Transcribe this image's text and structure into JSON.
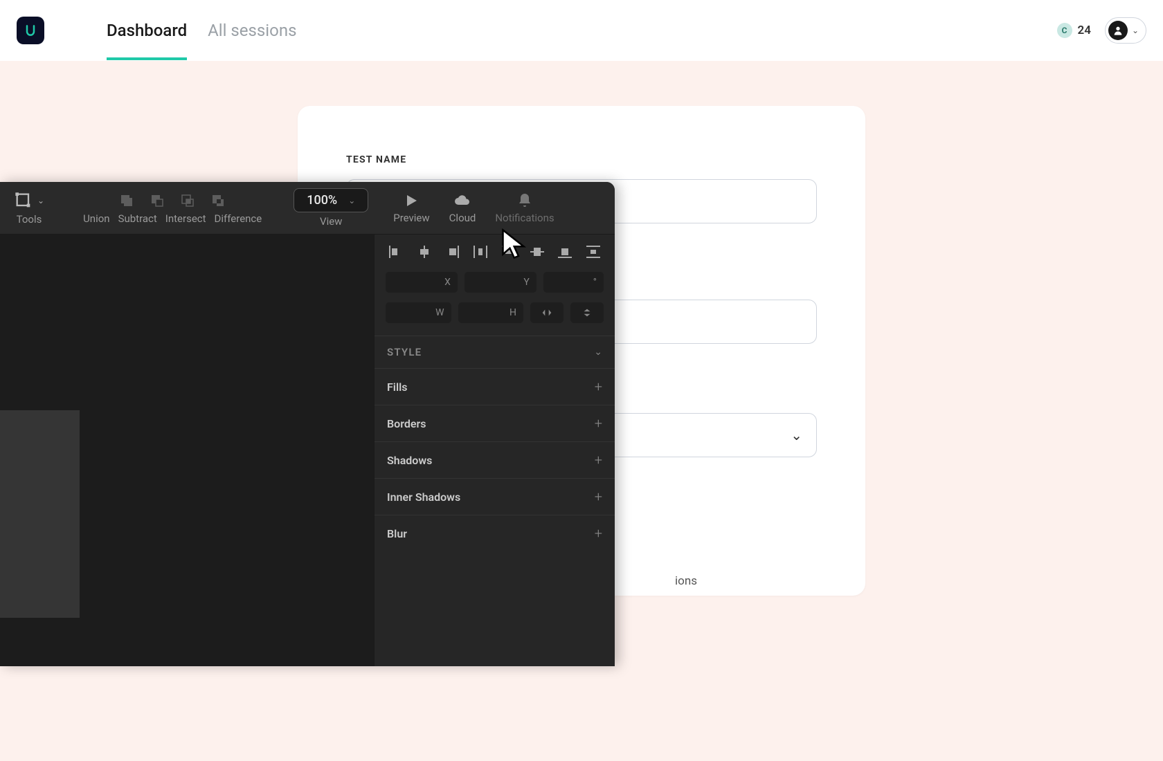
{
  "header": {
    "nav": {
      "dashboard": "Dashboard",
      "sessions": "All sessions"
    },
    "credits": "24"
  },
  "form": {
    "test_name_label": "TEST NAME",
    "sessions_fragment": "ions"
  },
  "toolbar": {
    "tools_label": "Tools",
    "union": "Union",
    "subtract": "Subtract",
    "intersect": "Intersect",
    "difference": "Difference",
    "view_label": "View",
    "zoom": "100%",
    "preview": "Preview",
    "cloud": "Cloud",
    "notifications": "Notifications"
  },
  "inspector": {
    "pos": {
      "x": "X",
      "y": "Y",
      "deg": "°",
      "w": "W",
      "h": "H"
    },
    "style_header": "STYLE",
    "fills": "Fills",
    "borders": "Borders",
    "shadows": "Shadows",
    "inner_shadows": "Inner Shadows",
    "blur": "Blur"
  }
}
